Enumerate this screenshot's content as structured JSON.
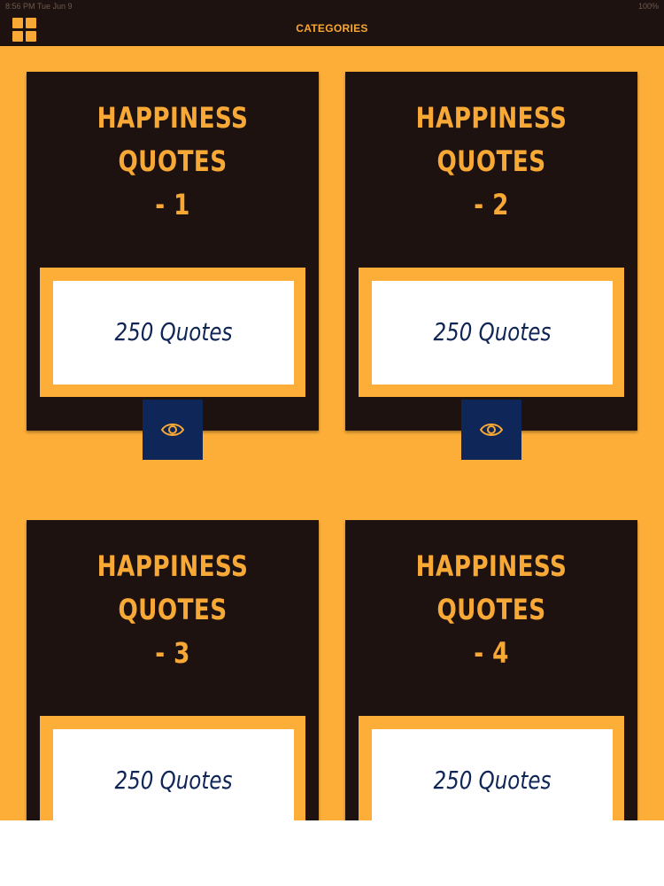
{
  "statusbar": {
    "time": "8:56 PM  Tue Jun 9",
    "battery": "100%"
  },
  "navbar": {
    "title": "CATEGORIES",
    "menu_icon": "grid-icon"
  },
  "colors": {
    "background": "#fdae38",
    "card": "#1e1210",
    "accent": "#f8a834",
    "button": "#0e2658",
    "count_text": "#0e2555"
  },
  "categories": [
    {
      "title_line1": "HAPPINESS QUOTES",
      "title_line2": "- 1",
      "count_label": "250 Quotes",
      "view_icon": "eye-icon"
    },
    {
      "title_line1": "HAPPINESS QUOTES",
      "title_line2": "- 2",
      "count_label": "250 Quotes",
      "view_icon": "eye-icon"
    },
    {
      "title_line1": "HAPPINESS QUOTES",
      "title_line2": "- 3",
      "count_label": "250 Quotes",
      "view_icon": "eye-icon"
    },
    {
      "title_line1": "HAPPINESS QUOTES",
      "title_line2": "- 4",
      "count_label": "250 Quotes",
      "view_icon": "eye-icon"
    }
  ]
}
